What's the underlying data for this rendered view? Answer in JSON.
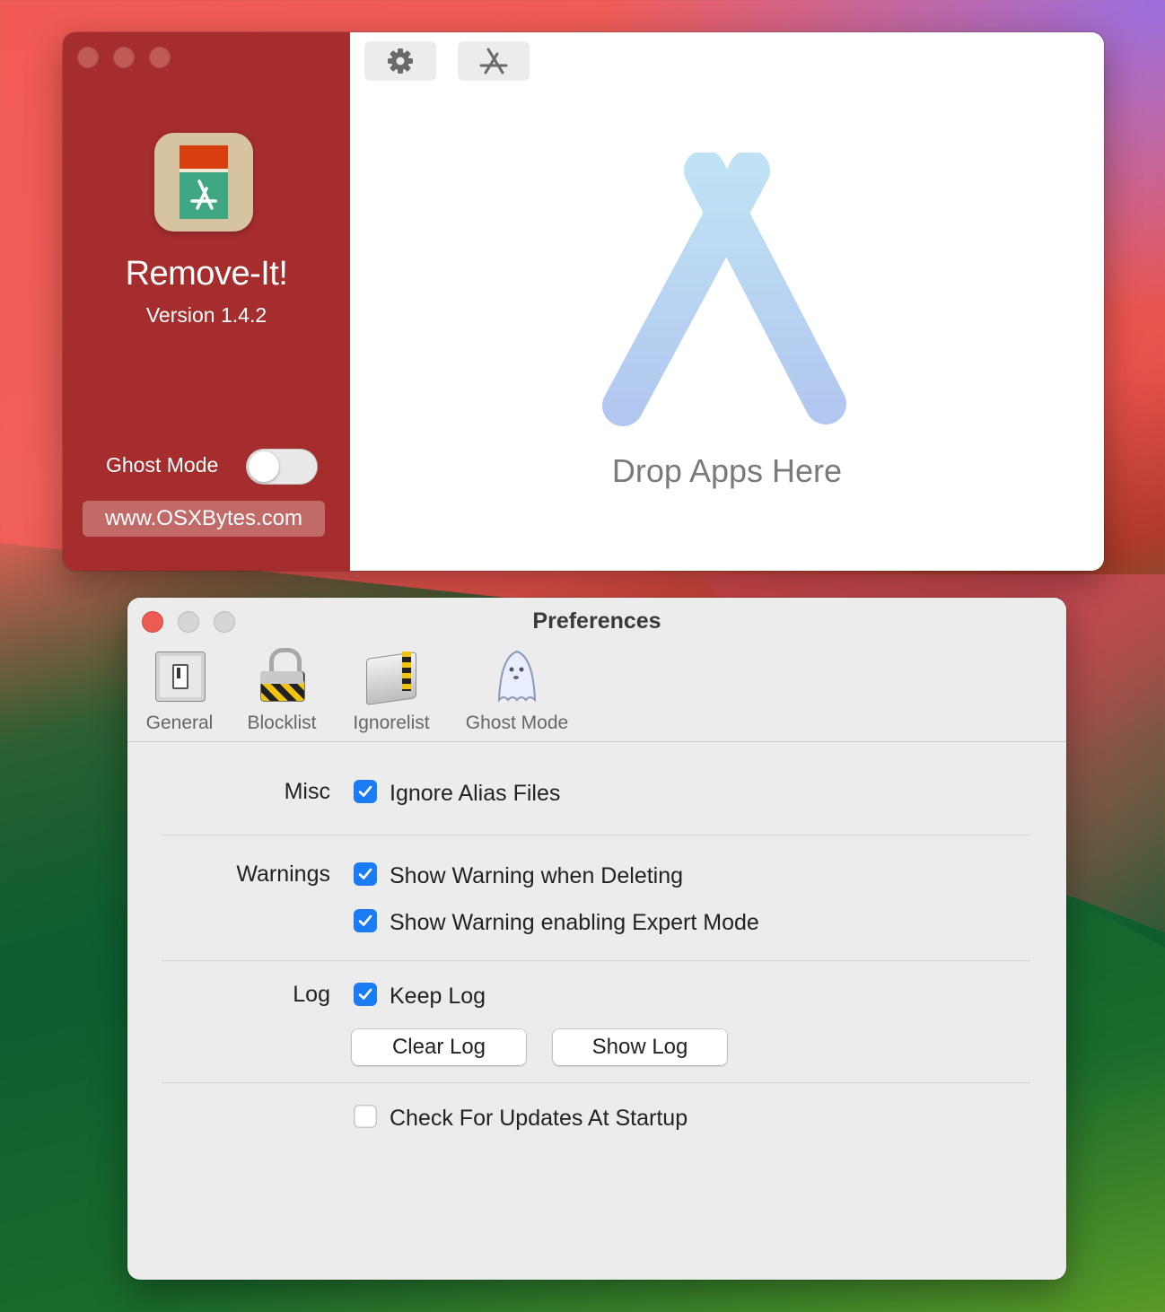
{
  "main_window": {
    "app_name": "Remove-It!",
    "version": "Version 1.4.2",
    "ghost_mode_label": "Ghost Mode",
    "ghost_mode_on": false,
    "website": "www.OSXBytes.com",
    "toolbar": {
      "settings_icon": "gear-icon",
      "app_store_icon": "app-store-icon"
    },
    "drop_text": "Drop Apps Here"
  },
  "preferences": {
    "title": "Preferences",
    "tabs": [
      {
        "label": "General",
        "icon": "switch-icon"
      },
      {
        "label": "Blocklist",
        "icon": "padlock-icon"
      },
      {
        "label": "Ignorelist",
        "icon": "folder-icon"
      },
      {
        "label": "Ghost Mode",
        "icon": "ghost-icon"
      }
    ],
    "sections": {
      "misc": {
        "label": "Misc",
        "ignore_alias": {
          "label": "Ignore Alias Files",
          "checked": true
        }
      },
      "warnings": {
        "label": "Warnings",
        "deleting": {
          "label": "Show Warning when Deleting",
          "checked": true
        },
        "expert": {
          "label": "Show Warning enabling Expert Mode",
          "checked": true
        }
      },
      "log": {
        "label": "Log",
        "keep": {
          "label": "Keep Log",
          "checked": true
        },
        "clear_button": "Clear Log",
        "show_button": "Show Log"
      },
      "updates": {
        "label": "Check For Updates At Startup",
        "checked": false
      }
    }
  },
  "colors": {
    "sidebar": "#a52d2d",
    "checkbox_accent": "#1a7cf4",
    "close_button": "#ee5b52",
    "drop_logo": "#b9d4f2"
  }
}
